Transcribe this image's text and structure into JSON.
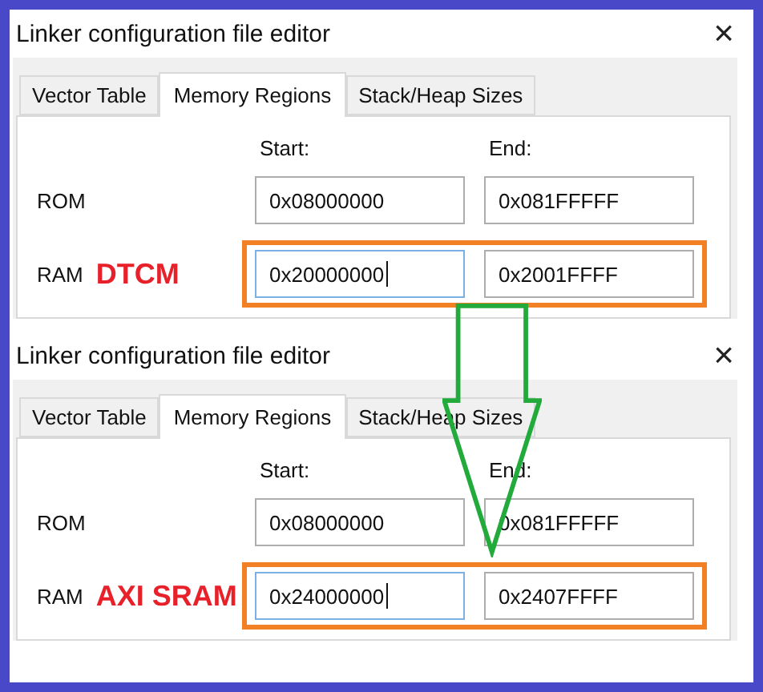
{
  "dialogs": [
    {
      "title": "Linker configuration file editor",
      "close": "×",
      "tabs": [
        {
          "label": "Vector Table",
          "selected": false
        },
        {
          "label": "Memory Regions",
          "selected": true
        },
        {
          "label": "Stack/Heap Sizes",
          "selected": false
        }
      ],
      "start_header": "Start:",
      "end_header": "End:",
      "rows": [
        {
          "label": "ROM",
          "highlighted": false,
          "start": {
            "value": "0x08000000",
            "focused": false
          },
          "end": {
            "value": "0x081FFFFF",
            "focused": false
          }
        },
        {
          "label": "RAM",
          "annotation": "DTCM",
          "highlighted": true,
          "start": {
            "value": "0x20000000",
            "focused": true
          },
          "end": {
            "value": "0x2001FFFF",
            "focused": false
          }
        }
      ]
    },
    {
      "title": "Linker configuration file editor",
      "close": "×",
      "tabs": [
        {
          "label": "Vector Table",
          "selected": false
        },
        {
          "label": "Memory Regions",
          "selected": true
        },
        {
          "label": "Stack/Heap Sizes",
          "selected": false
        }
      ],
      "start_header": "Start:",
      "end_header": "End:",
      "rows": [
        {
          "label": "ROM",
          "highlighted": false,
          "start": {
            "value": "0x08000000",
            "focused": false
          },
          "end": {
            "value": "0x081FFFFF",
            "focused": false
          }
        },
        {
          "label": "RAM",
          "annotation": "AXI SRAM",
          "highlighted": true,
          "start": {
            "value": "0x24000000",
            "focused": true
          },
          "end": {
            "value": "0x2407FFFF",
            "focused": false
          }
        }
      ]
    }
  ]
}
